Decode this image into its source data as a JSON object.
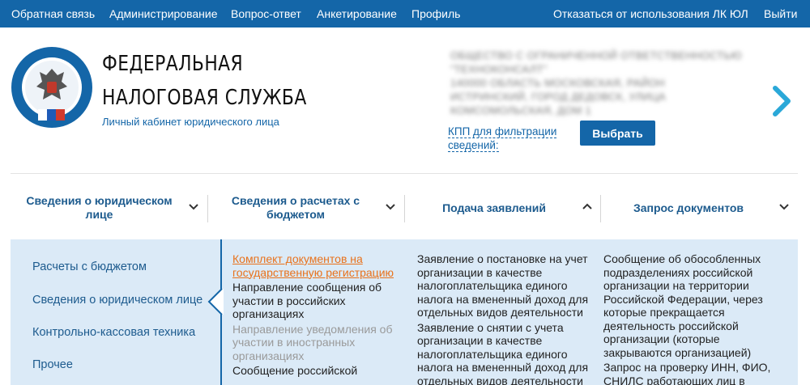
{
  "topbar": {
    "links": [
      "Обратная связь",
      "Администрирование",
      "Вопрос-ответ",
      "Анкетирование",
      "Профиль"
    ],
    "opt_out": "Отказаться от использования ЛК ЮЛ",
    "logout": "Выйти"
  },
  "header": {
    "brand_line1": "ФЕДЕРАЛЬНАЯ",
    "brand_line2": "НАЛОГОВАЯ СЛУЖБА",
    "subtitle": "Личный кабинет юридического лица",
    "org_blurred": [
      "ОБЩЕСТВО С ОГРАНИЧЕННОЙ ОТВЕТСТВЕННОСТЬЮ",
      "\"ТЕХНОКОНСАЛТ\"",
      "140000 ОБЛАСТЬ МОСКОВСКАЯ, РАЙОН",
      "ИСТРИНСКИЙ, ГОРОД ДЕДОВСК, УЛИЦА",
      "КОМСОМОЛЬСКАЯ, ДОМ 1"
    ],
    "kpp_label": "КПП для фильтрации сведений:",
    "select_button": "Выбрать",
    "colors": {
      "brand_blue": "#1466a8",
      "panel_bg": "#dbeaf7",
      "accent_orange": "#e8721c"
    }
  },
  "nav": {
    "tabs": [
      {
        "label": "Сведения о юридическом лице",
        "chevron": "chevron-down-icon"
      },
      {
        "label": "Сведения о расчетах с бюджетом",
        "chevron": "chevron-down-icon"
      },
      {
        "label": "Подача заявлений",
        "chevron": "chevron-up-icon"
      },
      {
        "label": "Запрос документов",
        "chevron": "chevron-down-icon"
      }
    ]
  },
  "panel": {
    "sidebar": [
      "Расчеты с бюджетом",
      "Сведения о юридическом лице",
      "Контрольно-кассовая техника",
      "Прочее"
    ],
    "col1": [
      "Комплект документов на государственную регистрацию",
      "Направление сообщения об участии в российских организациях",
      "Направление уведомления об участии в иностранных организациях",
      "Сообщение российской"
    ],
    "col2": [
      "Заявление о постановке на учет организации в качестве налогоплательщика единого налога на вмененный доход для отдельных видов деятельности",
      "Заявление о снятии с учета организации в качестве налогоплательщика единого налога на вмененный доход для отдельных видов деятельности"
    ],
    "col3": [
      "Сообщение об обособленных подразделениях российской организации на территории Российской Федерации, через которые прекращается деятельность российской организации (которые закрываются организацией)",
      "Запрос на проверку ИНН, ФИО, СНИЛС работающих лиц в"
    ]
  }
}
